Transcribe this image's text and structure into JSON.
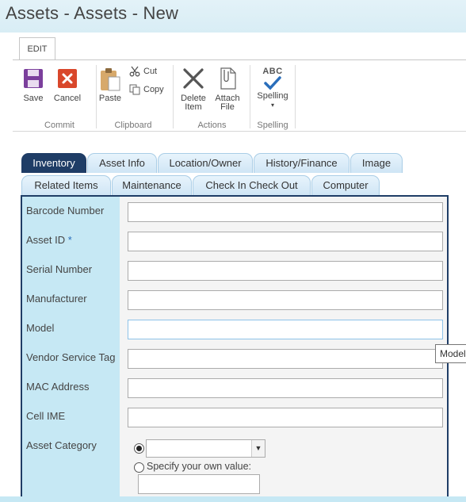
{
  "window": {
    "title": "Assets - Assets - New"
  },
  "ribbon": {
    "tab_label": "EDIT",
    "groups": {
      "commit": {
        "label": "Commit",
        "save": "Save",
        "cancel": "Cancel"
      },
      "clipboard": {
        "label": "Clipboard",
        "paste": "Paste",
        "cut": "Cut",
        "copy": "Copy"
      },
      "actions": {
        "label": "Actions",
        "delete_line1": "Delete",
        "delete_line2": "Item",
        "attach_line1": "Attach",
        "attach_line2": "File"
      },
      "spelling": {
        "label": "Spelling",
        "abc": "ABC",
        "spelling": "Spelling"
      }
    }
  },
  "form_tabs": {
    "row1": [
      "Inventory",
      "Asset Info",
      "Location/Owner",
      "History/Finance",
      "Image"
    ],
    "row2": [
      "Related Items",
      "Maintenance",
      "Check In Check Out",
      "Computer"
    ],
    "active": "Inventory"
  },
  "fields": {
    "barcode": {
      "label": "Barcode Number",
      "value": ""
    },
    "asset_id": {
      "label": "Asset ID",
      "required_mark": "*",
      "value": ""
    },
    "serial": {
      "label": "Serial Number",
      "value": ""
    },
    "manufacturer": {
      "label": "Manufacturer",
      "value": ""
    },
    "model": {
      "label": "Model",
      "value": ""
    },
    "vendor_tag": {
      "label": "Vendor Service Tag",
      "value": ""
    },
    "mac": {
      "label": "MAC Address",
      "value": ""
    },
    "cell_ime": {
      "label": "Cell IME",
      "value": ""
    },
    "asset_category": {
      "label": "Asset Category",
      "selected": "",
      "own_value_label": "Specify your own value:",
      "own_value": ""
    }
  },
  "tooltip": {
    "text": "Model"
  },
  "colors": {
    "active_tab": "#1f3d66",
    "label_column": "#c6e8f4",
    "title_bar": "#dbeef6",
    "save_icon": "#7b3f9c",
    "cancel_icon": "#d9472b",
    "check_icon": "#2a6ebb"
  }
}
